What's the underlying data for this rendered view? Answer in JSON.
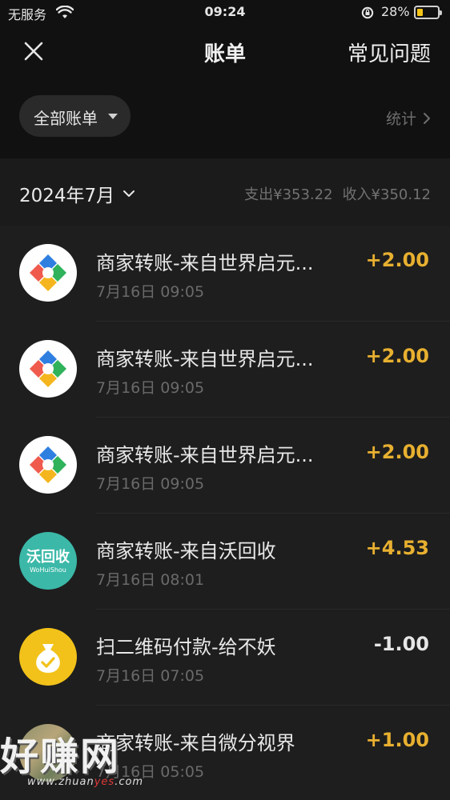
{
  "status_bar": {
    "carrier": "无服务",
    "time": "09:24",
    "battery_percent": "28%",
    "battery_level": 0.28,
    "icons": [
      "wifi-icon",
      "rotation-lock-icon",
      "battery-icon"
    ]
  },
  "nav": {
    "title": "账单",
    "faq_label": "常见问题",
    "close_icon": "close-icon"
  },
  "filter": {
    "label": "全部账单",
    "stats_label": "统计"
  },
  "summary": {
    "month": "2024年7月",
    "expense": "支出¥353.22",
    "income": "收入¥350.12"
  },
  "colors": {
    "background": "#111111",
    "list_background": "#1e1e1e",
    "income_amount": "#e8b030",
    "expense_amount": "#e6e6e6"
  },
  "transactions": [
    {
      "name": "商家转账-来自世界启元...",
      "time": "7月16日 09:05",
      "amount": "+2.00",
      "type": "income",
      "icon": "merchant-logo-icon"
    },
    {
      "name": "商家转账-来自世界启元...",
      "time": "7月16日 09:05",
      "amount": "+2.00",
      "type": "income",
      "icon": "merchant-logo-icon"
    },
    {
      "name": "商家转账-来自世界启元...",
      "time": "7月16日 09:05",
      "amount": "+2.00",
      "type": "income",
      "icon": "merchant-logo-icon"
    },
    {
      "name": "商家转账-来自沃回收",
      "time": "7月16日 08:01",
      "amount": "+4.53",
      "type": "income",
      "icon": "wohuishou-logo-icon",
      "logo_text": "沃回收",
      "logo_sub": "WoHuiShou"
    },
    {
      "name": "扫二维码付款-给不妖",
      "time": "7月16日 07:05",
      "amount": "-1.00",
      "type": "expense",
      "icon": "money-bag-icon"
    },
    {
      "name": "商家转账-来自微分视界",
      "time": "7月16日 05:05",
      "amount": "+1.00",
      "type": "income",
      "icon": "merchant-photo-avatar"
    }
  ],
  "watermark": {
    "text": "好赚网",
    "url_prefix": "www.zhuan",
    "url_mid": "yes",
    "url_suffix": ".com"
  }
}
